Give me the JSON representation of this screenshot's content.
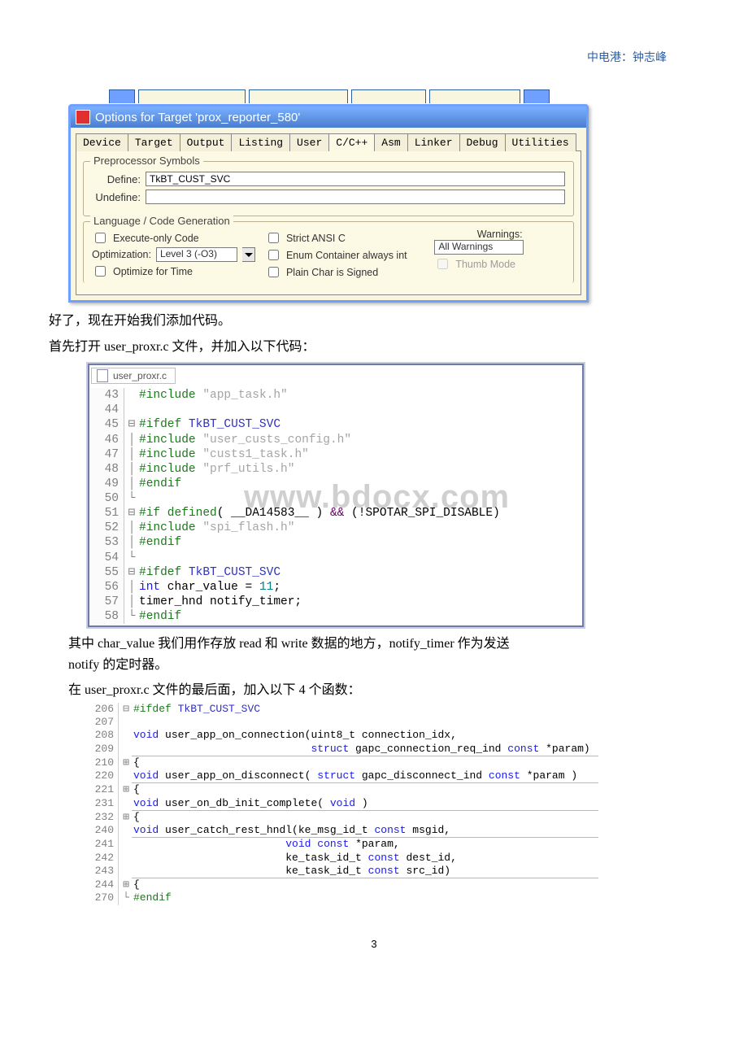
{
  "header": "中电港：钟志峰",
  "dialog": {
    "title": "Options for Target 'prox_reporter_580'",
    "tabs": [
      "Device",
      "Target",
      "Output",
      "Listing",
      "User",
      "C/C++",
      "Asm",
      "Linker",
      "Debug",
      "Utilities"
    ],
    "selected_tab": "C/C++",
    "pre_legend": "Preprocessor Symbols",
    "define_lbl": "Define:",
    "define_val": "TkBT_CUST_SVC",
    "undefine_lbl": "Undefine:",
    "lang_legend": "Language / Code Generation",
    "exec_only": "Execute-only Code",
    "opt_lbl": "Optimization:",
    "opt_val": "Level 3 (-O3)",
    "opt_time": "Optimize for Time",
    "strict": "Strict ANSI C",
    "enum": "Enum Container always int",
    "plain": "Plain Char is Signed",
    "warn_lbl": "Warnings:",
    "warn_val": "All Warnings",
    "thumb": "Thumb Mode"
  },
  "para1": "好了，现在开始我们添加代码。",
  "para2_a": "首先打开 ",
  "para2_b": "user_proxr.c",
  "para2_c": " 文件，并加入以下代码：",
  "code1": {
    "filename": "user_proxr.c",
    "lines": [
      {
        "n": "43",
        "fold": "",
        "src": [
          {
            "cls": "pp",
            "t": "#include "
          },
          {
            "cls": "str",
            "t": "\"app_task.h\""
          }
        ]
      },
      {
        "n": "44",
        "fold": "",
        "src": []
      },
      {
        "n": "45",
        "fold": "⊟",
        "src": [
          {
            "cls": "pp",
            "t": "#ifdef"
          },
          {
            "cls": "",
            "t": " "
          },
          {
            "cls": "ppblue",
            "t": "TkBT_CUST_SVC"
          }
        ]
      },
      {
        "n": "46",
        "fold": "│",
        "src": [
          {
            "cls": "pp",
            "t": "#include "
          },
          {
            "cls": "str",
            "t": "\"user_custs_config.h\""
          }
        ]
      },
      {
        "n": "47",
        "fold": "│",
        "src": [
          {
            "cls": "pp",
            "t": "#include "
          },
          {
            "cls": "str",
            "t": "\"custs1_task.h\""
          }
        ]
      },
      {
        "n": "48",
        "fold": "│",
        "src": [
          {
            "cls": "pp",
            "t": "#include "
          },
          {
            "cls": "str",
            "t": "\"prf_utils.h\""
          }
        ]
      },
      {
        "n": "49",
        "fold": "│",
        "src": [
          {
            "cls": "pp",
            "t": "#endif"
          }
        ]
      },
      {
        "n": "50",
        "fold": "└",
        "src": []
      },
      {
        "n": "51",
        "fold": "⊟",
        "src": [
          {
            "cls": "pp",
            "t": "#if defined"
          },
          {
            "cls": "",
            "t": "( __DA14583__ ) "
          },
          {
            "cls": "op",
            "t": "&&"
          },
          {
            "cls": "",
            "t": " (!SPOTAR_SPI_DISABLE)"
          }
        ]
      },
      {
        "n": "52",
        "fold": "│",
        "src": [
          {
            "cls": "pp",
            "t": "#include "
          },
          {
            "cls": "str",
            "t": "\"spi_flash.h\""
          }
        ]
      },
      {
        "n": "53",
        "fold": "│",
        "src": [
          {
            "cls": "pp",
            "t": "#endif"
          }
        ]
      },
      {
        "n": "54",
        "fold": "└",
        "src": []
      },
      {
        "n": "55",
        "fold": "⊟",
        "src": [
          {
            "cls": "pp",
            "t": "#ifdef"
          },
          {
            "cls": "",
            "t": " "
          },
          {
            "cls": "ppblue",
            "t": "TkBT_CUST_SVC"
          }
        ]
      },
      {
        "n": "56",
        "fold": "│",
        "src": [
          {
            "cls": "kw",
            "t": "int"
          },
          {
            "cls": "",
            "t": " char_value = "
          },
          {
            "cls": "num",
            "t": "11"
          },
          {
            "cls": "",
            "t": ";"
          }
        ]
      },
      {
        "n": "57",
        "fold": "│",
        "src": [
          {
            "cls": "",
            "t": "timer_hnd notify_timer;"
          }
        ]
      },
      {
        "n": "58",
        "fold": "└",
        "src": [
          {
            "cls": "pp",
            "t": "#endif"
          }
        ]
      }
    ]
  },
  "watermark": "www.bdocx.com",
  "para3_a": "其中 ",
  "para3_b": "char_value",
  "para3_c": " 我们用作存放 ",
  "para3_d": "read",
  "para3_e": " 和 ",
  "para3_f": "write",
  "para3_g": " 数据的地方，",
  "para3_h": "notify_timer",
  "para3_i": " 作为发送 ",
  "para3_j": "notify",
  "para3_k": " 的定时器。",
  "para4_a": "在 ",
  "para4_b": "user_proxr.c",
  "para4_c": " 文件的最后面，加入以下 ",
  "para4_d": "4",
  "para4_e": " 个函数：",
  "code2": {
    "lines": [
      {
        "n": "206",
        "fold": "⊟",
        "u": 0,
        "src": [
          {
            "cls": "pp",
            "t": "#ifdef"
          },
          {
            "cls": "",
            "t": " "
          },
          {
            "cls": "ppblue",
            "t": "TkBT_CUST_SVC"
          }
        ]
      },
      {
        "n": "207",
        "fold": "",
        "u": 0,
        "src": []
      },
      {
        "n": "208",
        "fold": "",
        "u": 0,
        "src": [
          {
            "cls": "kw",
            "t": "void"
          },
          {
            "cls": "",
            "t": " user_app_on_connection(uint8_t connection_idx,"
          }
        ]
      },
      {
        "n": "209",
        "fold": "",
        "u": 1,
        "src": [
          {
            "cls": "",
            "t": "                            "
          },
          {
            "cls": "kw",
            "t": "struct"
          },
          {
            "cls": "",
            "t": " gapc_connection_req_ind "
          },
          {
            "cls": "kw",
            "t": "const"
          },
          {
            "cls": "",
            "t": " *param)"
          }
        ]
      },
      {
        "n": "210",
        "fold": "⊞",
        "u": 0,
        "src": [
          {
            "cls": "",
            "t": "{"
          }
        ]
      },
      {
        "n": "220",
        "fold": "",
        "u": 1,
        "src": [
          {
            "cls": "kw",
            "t": "void"
          },
          {
            "cls": "",
            "t": " user_app_on_disconnect( "
          },
          {
            "cls": "kw",
            "t": "struct"
          },
          {
            "cls": "",
            "t": " gapc_disconnect_ind "
          },
          {
            "cls": "kw",
            "t": "const"
          },
          {
            "cls": "",
            "t": " *param )"
          }
        ]
      },
      {
        "n": "221",
        "fold": "⊞",
        "u": 0,
        "src": [
          {
            "cls": "",
            "t": "{"
          }
        ]
      },
      {
        "n": "231",
        "fold": "",
        "u": 1,
        "src": [
          {
            "cls": "kw",
            "t": "void"
          },
          {
            "cls": "",
            "t": " user_on_db_init_complete( "
          },
          {
            "cls": "kw",
            "t": "void"
          },
          {
            "cls": "",
            "t": " )"
          }
        ]
      },
      {
        "n": "232",
        "fold": "⊞",
        "u": 0,
        "src": [
          {
            "cls": "",
            "t": "{"
          }
        ]
      },
      {
        "n": "240",
        "fold": "",
        "u": 1,
        "src": [
          {
            "cls": "kw",
            "t": "void"
          },
          {
            "cls": "",
            "t": " user_catch_rest_hndl(ke_msg_id_t "
          },
          {
            "cls": "kw",
            "t": "const"
          },
          {
            "cls": "",
            "t": " msgid,"
          }
        ]
      },
      {
        "n": "241",
        "fold": "",
        "u": 0,
        "src": [
          {
            "cls": "",
            "t": "                        "
          },
          {
            "cls": "kw",
            "t": "void"
          },
          {
            "cls": "",
            "t": " "
          },
          {
            "cls": "kw",
            "t": "const"
          },
          {
            "cls": "",
            "t": " *param,"
          }
        ]
      },
      {
        "n": "242",
        "fold": "",
        "u": 0,
        "src": [
          {
            "cls": "",
            "t": "                        ke_task_id_t "
          },
          {
            "cls": "kw",
            "t": "const"
          },
          {
            "cls": "",
            "t": " dest_id,"
          }
        ]
      },
      {
        "n": "243",
        "fold": "",
        "u": 1,
        "src": [
          {
            "cls": "",
            "t": "                        ke_task_id_t "
          },
          {
            "cls": "kw",
            "t": "const"
          },
          {
            "cls": "",
            "t": " src_id)"
          }
        ]
      },
      {
        "n": "244",
        "fold": "⊞",
        "u": 0,
        "src": [
          {
            "cls": "",
            "t": "{"
          }
        ]
      },
      {
        "n": "270",
        "fold": "└",
        "u": 0,
        "src": [
          {
            "cls": "pp",
            "t": "#endif"
          }
        ]
      }
    ]
  },
  "pgno": "3"
}
